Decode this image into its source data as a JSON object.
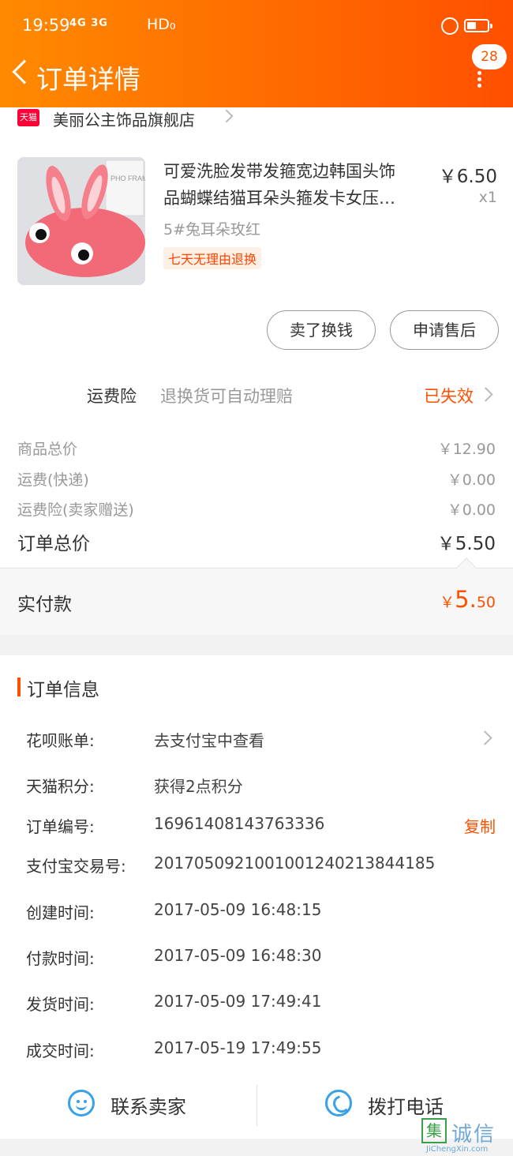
{
  "status_bar": {
    "time": "19:59",
    "network": "4G 3G",
    "hd": "HD₀"
  },
  "nav": {
    "title": "订单详情",
    "badge_count": "28",
    "back_icon": "chevron-left-icon",
    "more_icon": "vertical-dots-icon"
  },
  "shop": {
    "logo_text": "天猫",
    "name": "美丽公主饰品旗舰店"
  },
  "product": {
    "title_line1": "可爱洗脸发带发箍宽边韩国头饰",
    "title_line2": "品蝴蝶结猫耳朵头箍发卡女压…",
    "price": "￥6.50",
    "qty": "x1",
    "sku": "5#兔耳朵玫红",
    "tag": "七天无理由退换",
    "thumb_text": "PHO FRAME"
  },
  "actions": {
    "sell": "卖了换钱",
    "after_sale": "申请售后"
  },
  "insurance": {
    "label": "运费险",
    "desc": "退换货可自动理赔",
    "status": "已失效"
  },
  "fees": [
    {
      "label": "商品总价",
      "value": "￥12.90"
    },
    {
      "label": "运费(快递)",
      "value": "￥0.00"
    },
    {
      "label": "运费险(卖家赠送)",
      "value": "￥0.00"
    }
  ],
  "total": {
    "label": "订单总价",
    "value": "￥5.50"
  },
  "paid": {
    "label": "实付款",
    "currency": "￥",
    "int": "5.",
    "dec": "50"
  },
  "order_info": {
    "title": "订单信息",
    "rows": [
      {
        "k": "花呗账单:",
        "v": "去支付宝中查看"
      },
      {
        "k": "天猫积分:",
        "v": "获得2点积分"
      },
      {
        "k": "订单编号:",
        "v": "16961408143763336",
        "action": "复制"
      },
      {
        "k": "支付宝交易号:",
        "v": "2017050921001001240213844185"
      },
      {
        "k": "创建时间:",
        "v": "2017-05-09 16:48:15"
      },
      {
        "k": "付款时间:",
        "v": "2017-05-09 16:48:30"
      },
      {
        "k": "发货时间:",
        "v": "2017-05-09 17:49:41"
      },
      {
        "k": "成交时间:",
        "v": "2017-05-19 17:49:55"
      }
    ]
  },
  "contact": {
    "seller": "联系卖家",
    "phone": "拨打电话"
  },
  "watermark": {
    "box": "集",
    "text": "诚信",
    "url": "JiChengXin.com"
  }
}
